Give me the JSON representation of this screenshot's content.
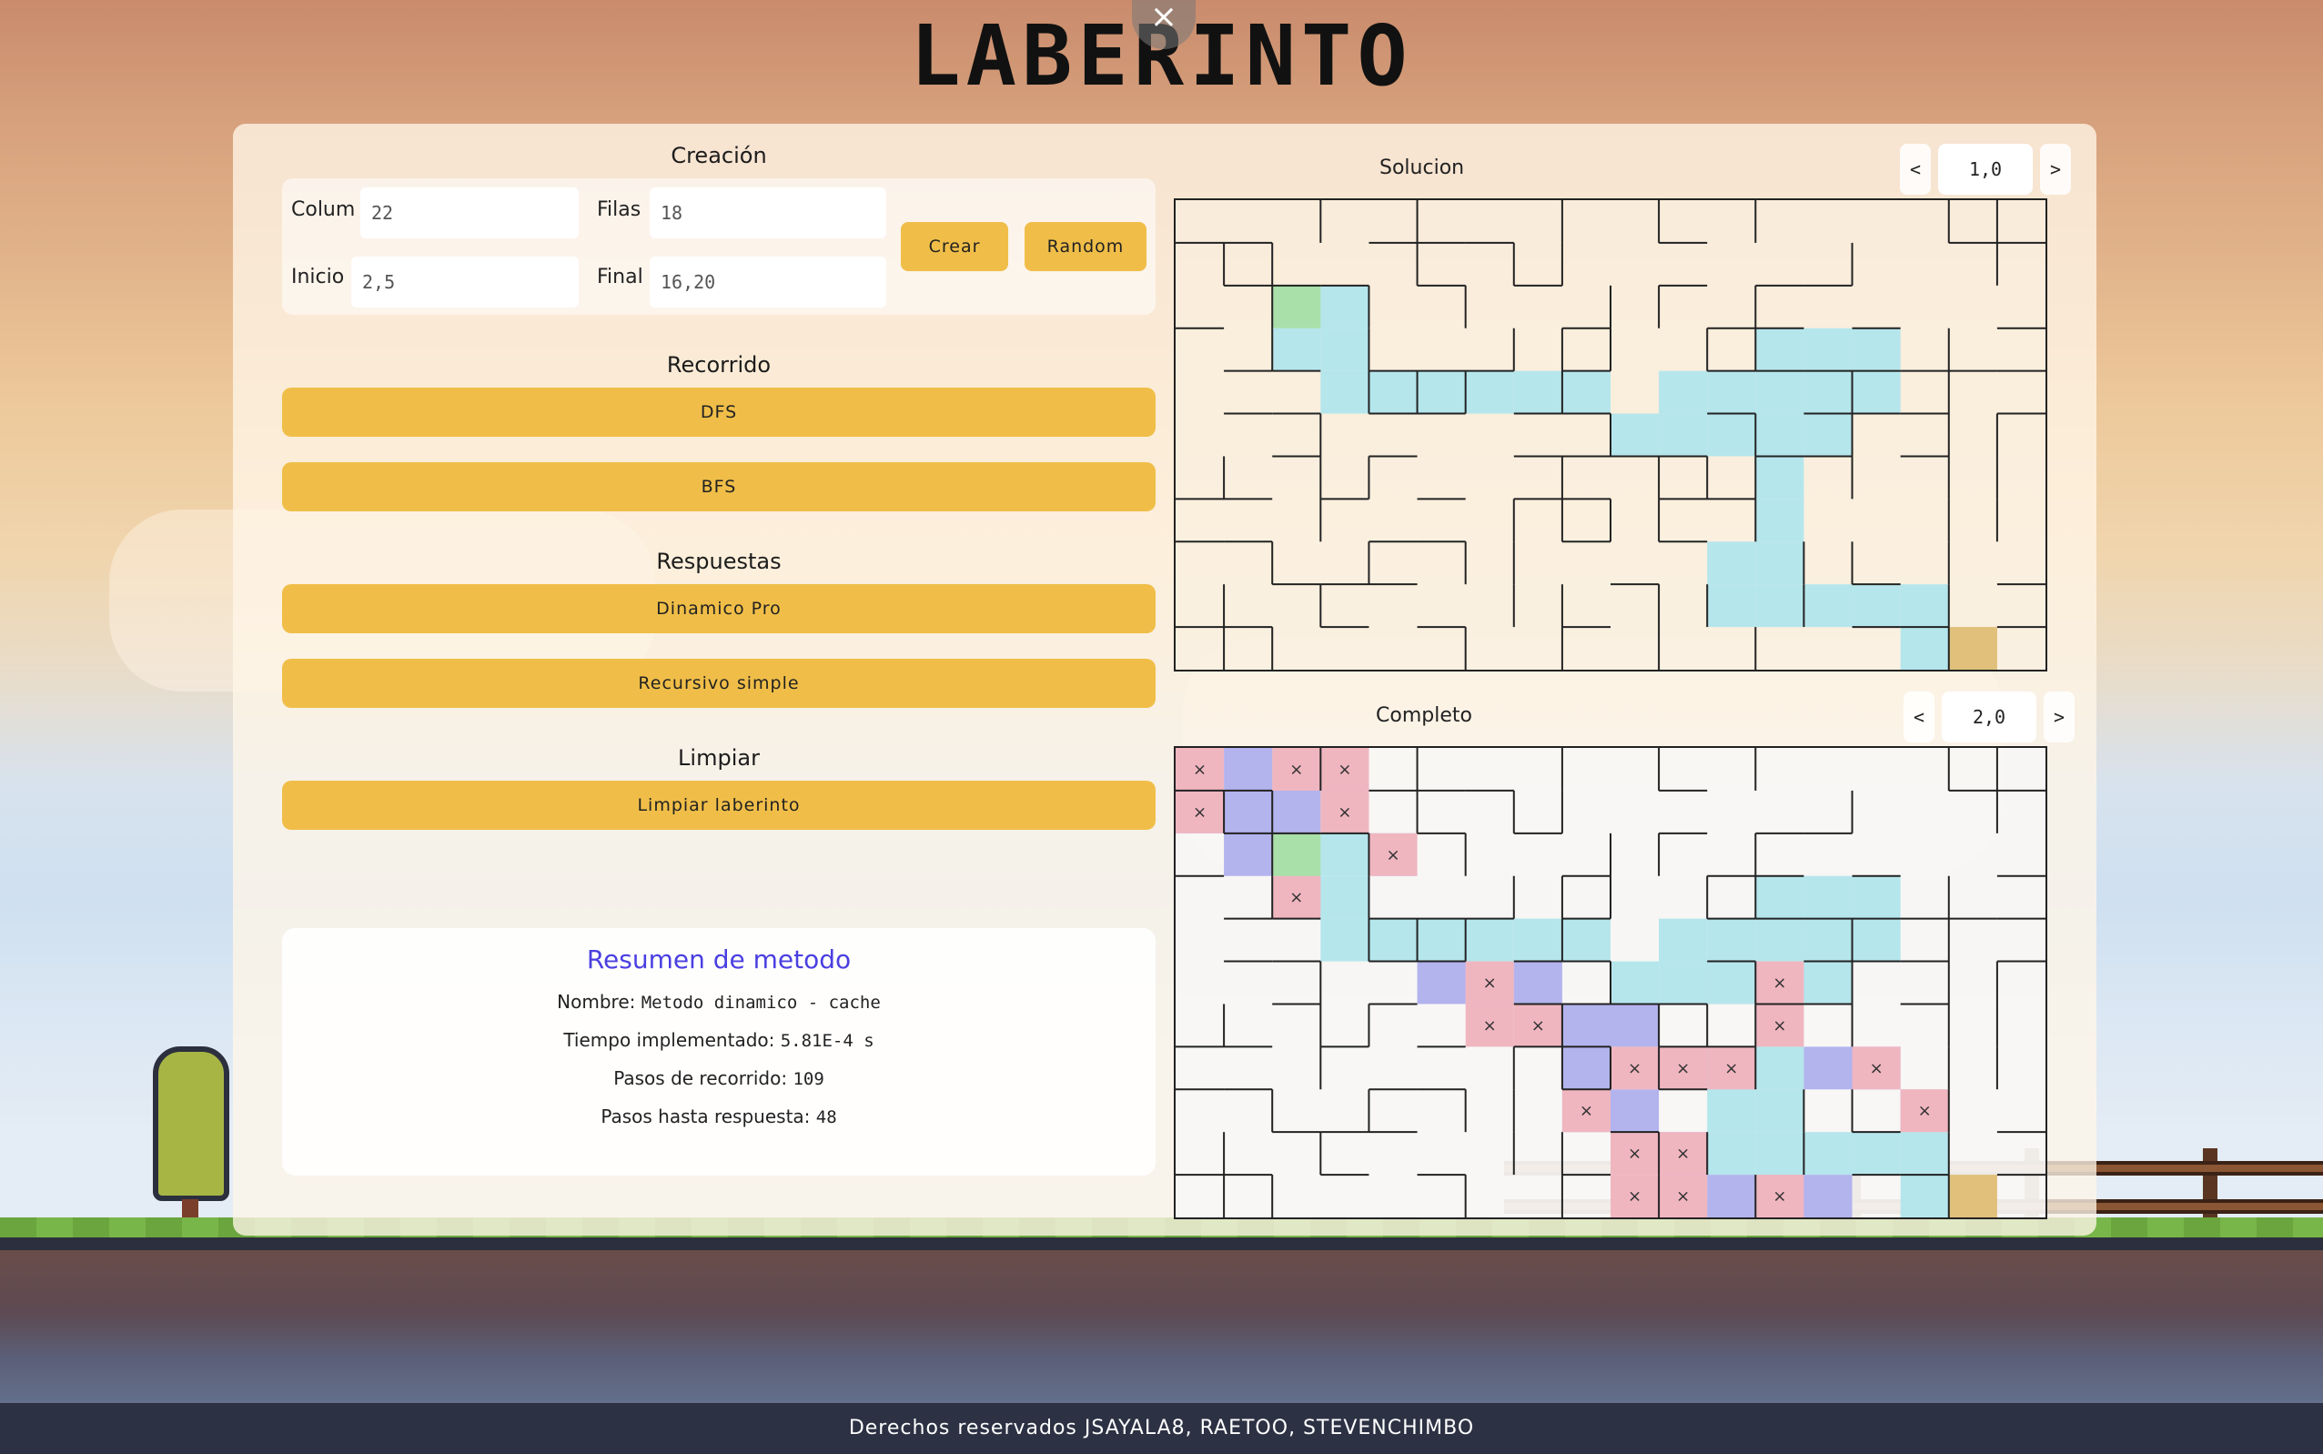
{
  "app": {
    "title": "LABERINTO",
    "close_glyph": "×"
  },
  "creation": {
    "title": "Creación",
    "columns_label": "Colum",
    "columns_value": "22",
    "rows_label": "Filas",
    "rows_value": "18",
    "start_label": "Inicio",
    "start_value": "2,5",
    "end_label": "Final",
    "end_value": "16,20",
    "create_button": "Crear",
    "random_button": "Random"
  },
  "traversal": {
    "title": "Recorrido",
    "dfs_button": "DFS",
    "bfs_button": "BFS"
  },
  "answers": {
    "title": "Respuestas",
    "dynamic_button": "Dinamico Pro",
    "recursive_button": "Recursivo simple"
  },
  "clear": {
    "title": "Limpiar",
    "clear_button": "Limpiar laberinto"
  },
  "summary": {
    "title": "Resumen de metodo",
    "name_label": "Nombre:",
    "name_value": "Metodo dinamico - cache",
    "time_label": "Tiempo implementado:",
    "time_value": "5.81E-4 s",
    "steps_label": "Pasos de recorrido:",
    "steps_value": "109",
    "answer_label": "Pasos hasta respuesta:",
    "answer_value": "48"
  },
  "solution_maze": {
    "title": "Solucion",
    "speed": "1,0",
    "prev": "<",
    "next": ">"
  },
  "complete_maze": {
    "title": "Completo",
    "speed": "2,0",
    "prev": "<",
    "next": ">"
  },
  "maze_grid": {
    "columns": 18,
    "rows": 11,
    "start_cell": [
      2,
      2
    ],
    "end_cell": [
      16,
      10
    ]
  },
  "colors": {
    "accent": "#f0be48",
    "path": "#b5e6ec",
    "visited": "#b3b3ee",
    "dead_end": "#f0b6c0",
    "start": "#a9dfa9",
    "end": "#e0c07a",
    "summary_title": "#4a3fe0"
  },
  "footer": {
    "text": "Derechos reservados JSAYALA8, RAETOO, STEVENCHIMBO"
  }
}
